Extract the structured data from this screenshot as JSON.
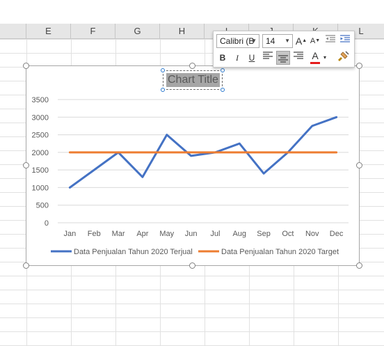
{
  "columns": [
    "",
    "E",
    "F",
    "G",
    "H",
    "I",
    "J",
    "K",
    "L"
  ],
  "toolbar": {
    "font_name": "Calibri (B",
    "font_size": "14",
    "grow_font_label": "A",
    "shrink_font_label": "A",
    "bold_label": "B",
    "italic_label": "I",
    "underline_label": "U",
    "font_color_label": "A",
    "font_color_hex": "#e51c1c"
  },
  "chart_data": {
    "type": "line",
    "title": "Chart Title",
    "categories": [
      "Jan",
      "Feb",
      "Mar",
      "Apr",
      "May",
      "Jun",
      "Jul",
      "Aug",
      "Sep",
      "Oct",
      "Nov",
      "Dec"
    ],
    "series": [
      {
        "name": "Data Penjualan Tahun 2020 Terjual",
        "color": "#4472c4",
        "values": [
          1000,
          1500,
          2000,
          1300,
          2500,
          1900,
          2000,
          2250,
          1400,
          2000,
          2750,
          3000
        ]
      },
      {
        "name": "Data Penjualan Tahun 2020 Target",
        "color": "#ed7d31",
        "values": [
          2000,
          2000,
          2000,
          2000,
          2000,
          2000,
          2000,
          2000,
          2000,
          2000,
          2000,
          2000
        ]
      }
    ],
    "ylim": [
      0,
      3500
    ],
    "yticks": [
      0,
      500,
      1000,
      1500,
      2000,
      2500,
      3000,
      3500
    ],
    "grid": true,
    "legend_position": "bottom"
  }
}
